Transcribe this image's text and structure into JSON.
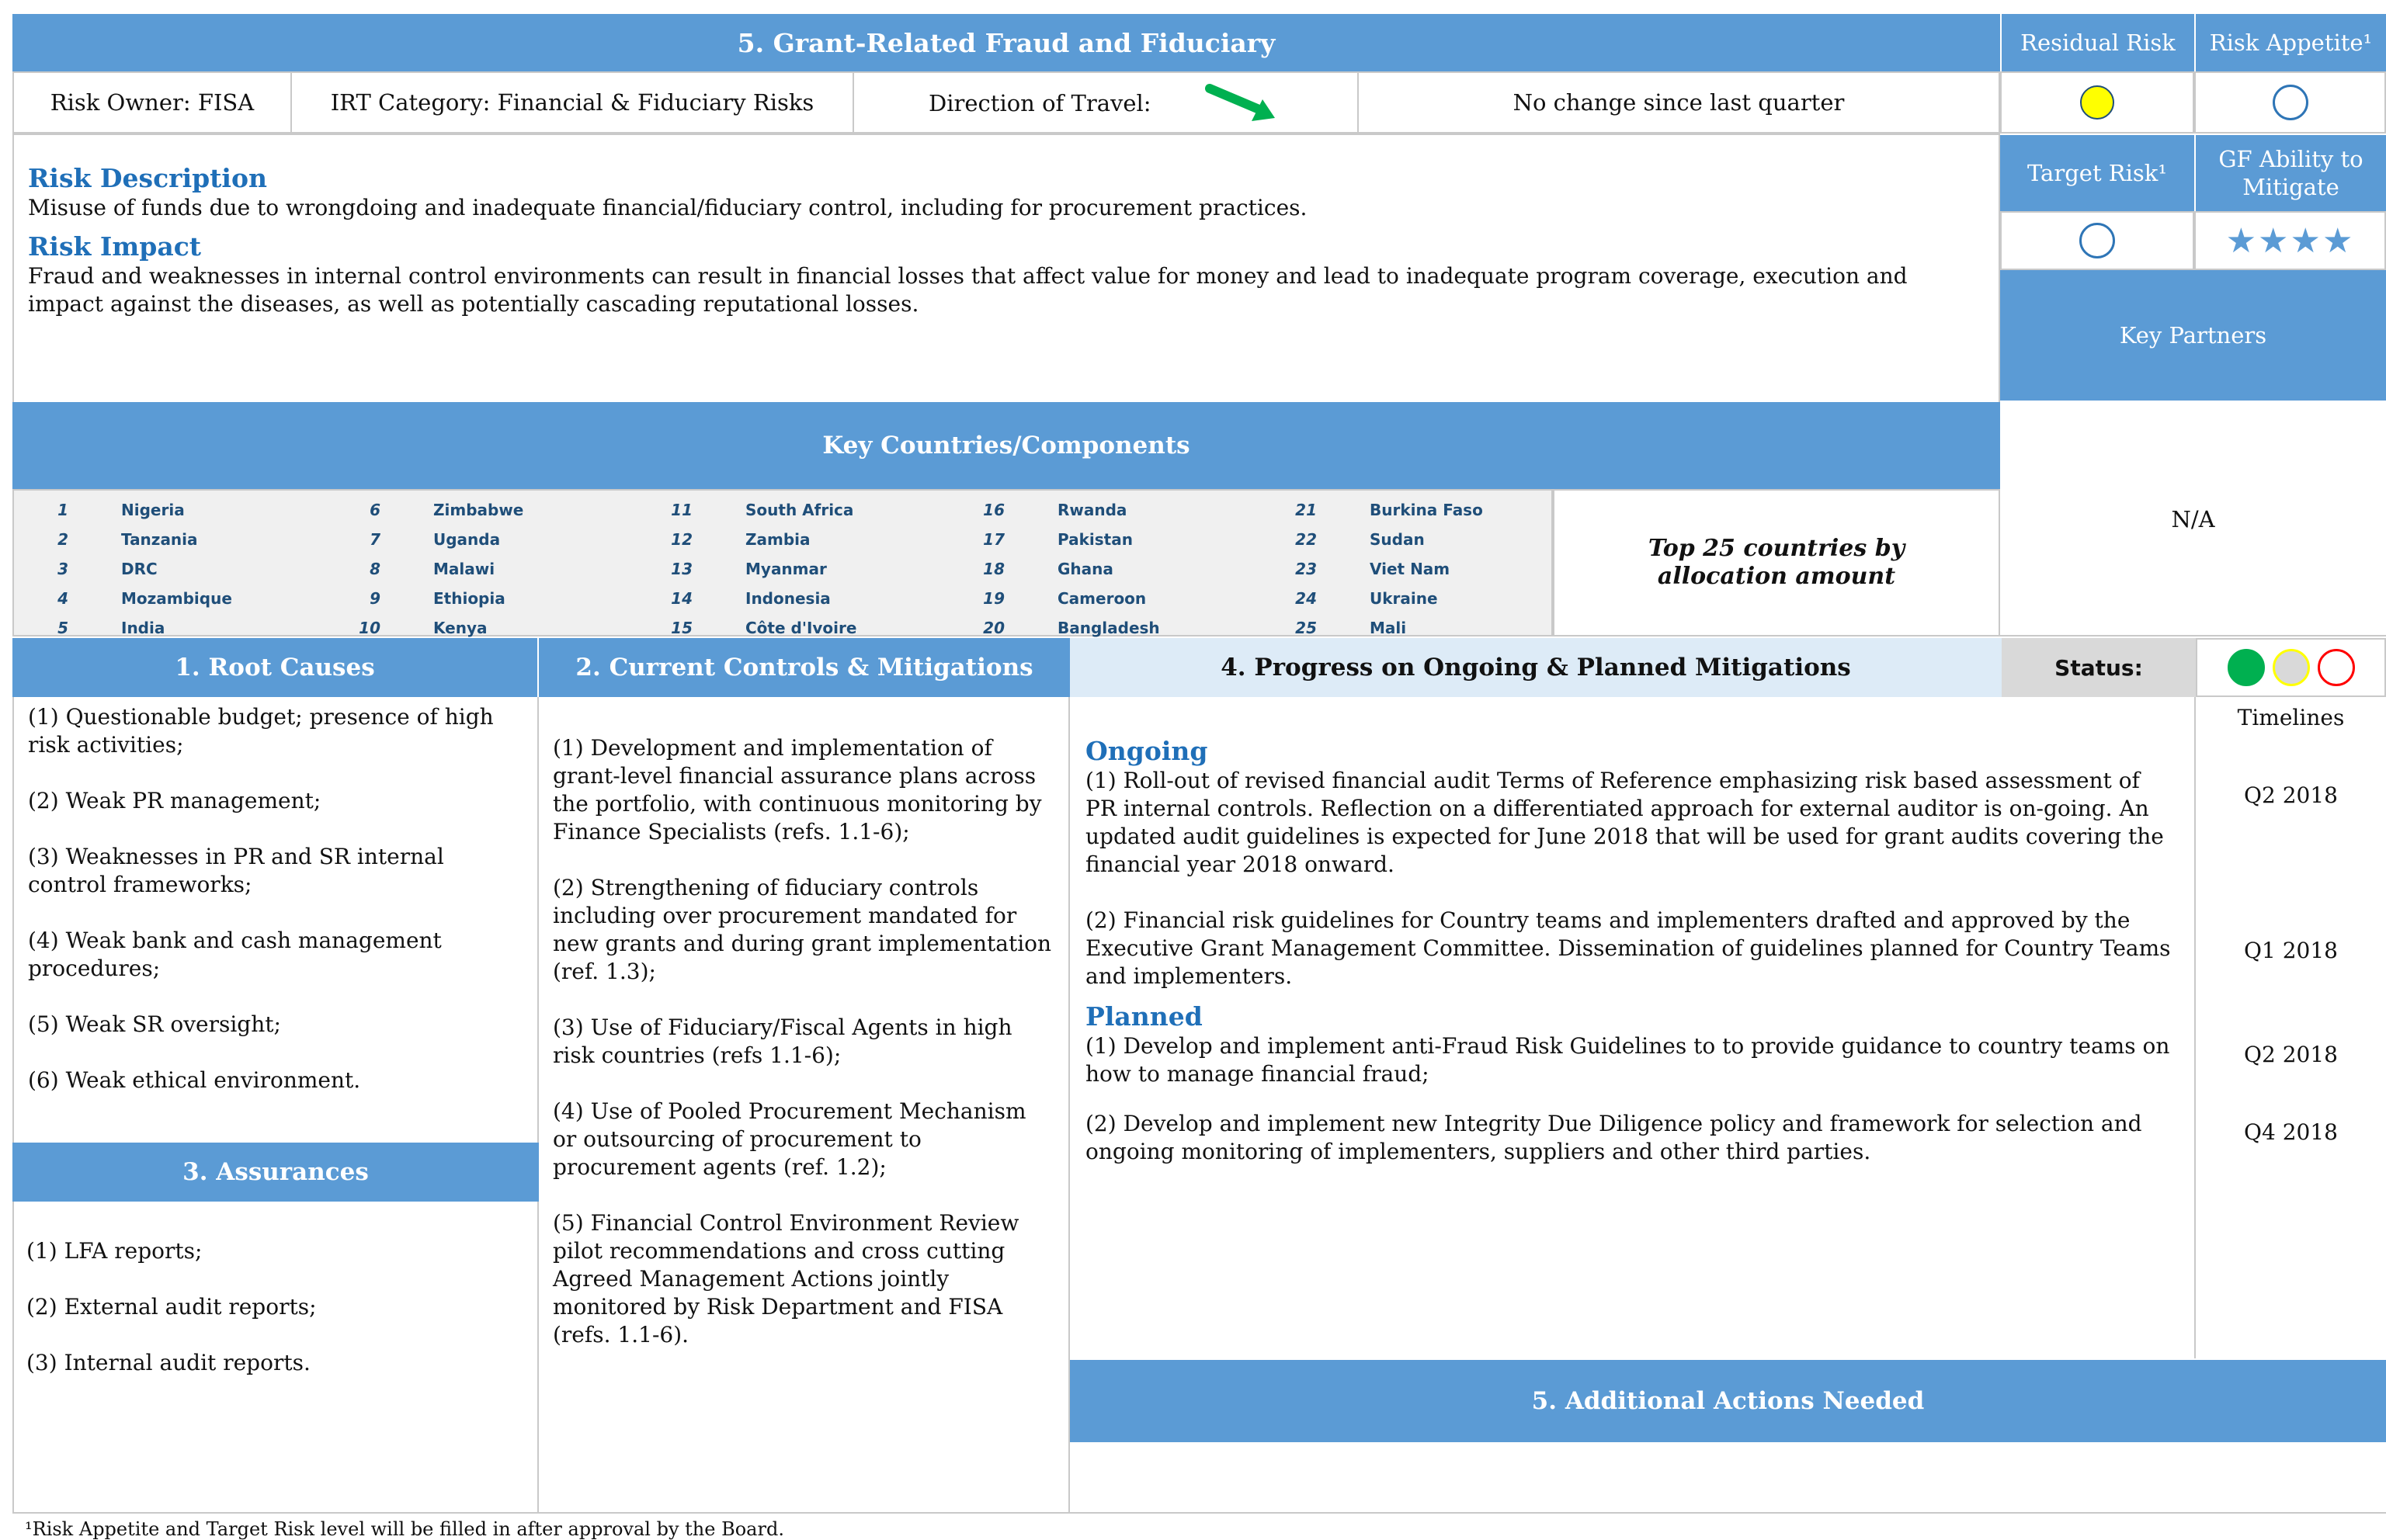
{
  "header": {
    "title": "5. Grant-Related Fraud and Fiduciary",
    "residual_risk_label": "Residual Risk",
    "risk_appetite_label": "Risk Appetite¹",
    "target_risk_label": "Target Risk¹",
    "gf_ability_label": "GF Ability to Mitigate",
    "key_partners_label": "Key Partners",
    "key_partners_value": "N/A"
  },
  "info_row": {
    "risk_owner": "Risk Owner: FISA",
    "irt_category": "IRT Category:  Financial & Fiduciary Risks",
    "direction_label": "Direction of Travel:",
    "direction_note": "No change since last quarter"
  },
  "ratings": {
    "residual_risk_color": "#ffff00",
    "gf_ability_stars": "★★★★",
    "gf_ability_star_count": 4
  },
  "description": {
    "risk_description_heading": "Risk Description",
    "risk_description_text": "Misuse of funds due to wrongdoing and inadequate financial/fiduciary control, including for procurement practices.",
    "risk_impact_heading": "Risk Impact",
    "risk_impact_text": "Fraud and weaknesses in internal control environments can result in financial losses that affect value for money and lead to inadequate program coverage, execution and impact against the diseases, as well as potentially cascading reputational losses."
  },
  "key_countries": {
    "heading": "Key Countries/Components",
    "note": "Top 25 countries by allocation amount",
    "items": [
      {
        "num": "1",
        "name": "Nigeria"
      },
      {
        "num": "6",
        "name": "Zimbabwe"
      },
      {
        "num": "11",
        "name": "South Africa"
      },
      {
        "num": "16",
        "name": "Rwanda"
      },
      {
        "num": "21",
        "name": "Burkina Faso"
      },
      {
        "num": "2",
        "name": "Tanzania"
      },
      {
        "num": "7",
        "name": "Uganda"
      },
      {
        "num": "12",
        "name": "Zambia"
      },
      {
        "num": "17",
        "name": "Pakistan"
      },
      {
        "num": "22",
        "name": "Sudan"
      },
      {
        "num": "3",
        "name": "DRC"
      },
      {
        "num": "8",
        "name": "Malawi"
      },
      {
        "num": "13",
        "name": "Myanmar"
      },
      {
        "num": "18",
        "name": "Ghana"
      },
      {
        "num": "23",
        "name": "Viet Nam"
      },
      {
        "num": "4",
        "name": "Mozambique"
      },
      {
        "num": "9",
        "name": "Ethiopia"
      },
      {
        "num": "14",
        "name": "Indonesia"
      },
      {
        "num": "19",
        "name": "Cameroon"
      },
      {
        "num": "24",
        "name": "Ukraine"
      },
      {
        "num": "5",
        "name": "India"
      },
      {
        "num": "10",
        "name": "Kenya"
      },
      {
        "num": "15",
        "name": "Côte d'Ivoire"
      },
      {
        "num": "20",
        "name": "Bangladesh"
      },
      {
        "num": "25",
        "name": "Mali"
      }
    ]
  },
  "root_causes": {
    "heading": "1. Root Causes",
    "items": [
      "(1) Questionable budget; presence of high risk activities;",
      "(2) Weak PR management;",
      "(3) Weaknesses in PR and SR internal control frameworks;",
      "(4) Weak bank and cash management procedures;",
      "(5) Weak SR oversight;",
      "(6) Weak ethical environment."
    ]
  },
  "assurances": {
    "heading": "3. Assurances",
    "items": [
      "(1)  LFA reports;",
      "(2) External audit reports;",
      "(3) Internal audit reports."
    ]
  },
  "controls": {
    "heading": "2. Current Controls & Mitigations",
    "items": [
      "(1) Development and implementation of grant-level financial assurance plans across the portfolio, with continuous monitoring by Finance Specialists (refs. 1.1-6);",
      "(2) Strengthening of fiduciary controls including over procurement mandated for new grants and during grant implementation (ref. 1.3);",
      "(3) Use of Fiduciary/Fiscal Agents in high risk countries (refs 1.1-6);",
      "(4) Use of Pooled Procurement Mechanism or outsourcing of procurement to procurement agents (ref. 1.2);",
      "(5) Financial Control Environment Review pilot recommendations and cross cutting Agreed Management Actions jointly monitored by Risk Department and FISA (refs. 1.1-6)."
    ]
  },
  "progress": {
    "heading": "4. Progress on Ongoing & Planned Mitigations",
    "status_label": "Status:",
    "status_colors": {
      "green": "#00b050",
      "yellow": "#ffff00",
      "red": "#ff0000"
    },
    "ongoing_heading": "Ongoing",
    "ongoing_items": [
      "(1) Roll-out of revised financial audit Terms of Reference emphasizing risk based assessment of PR internal controls. Reflection on a differentiated approach for external auditor is on-going. An updated audit guidelines is expected for June 2018 that will be used for grant audits covering the financial year 2018 onward.",
      "(2) Financial risk guidelines for Country teams and implementers drafted and approved by the Executive Grant Management Committee. Dissemination of guidelines planned for Country Teams and implementers."
    ],
    "planned_heading": "Planned",
    "planned_items": [
      "(1) Develop and implement anti-Fraud Risk Guidelines to to provide guidance to country teams on how to manage financial fraud;",
      "(2) Develop and implement new Integrity Due Diligence policy and framework for selection and ongoing monitoring of implementers, suppliers and other third parties."
    ],
    "timelines_label": "Timelines",
    "timelines": [
      "Q2 2018",
      "Q1 2018",
      "Q2 2018",
      "Q4 2018"
    ]
  },
  "additional_actions": {
    "heading": "5.  Additional Actions Needed"
  },
  "footnote": "¹Risk Appetite and Target Risk level will be filled in after approval by the Board."
}
